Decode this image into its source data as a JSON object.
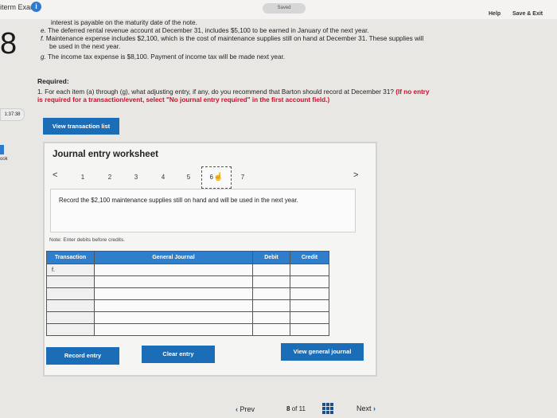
{
  "header": {
    "exam_title": "iterm Exam",
    "saved_label": "Saved",
    "help_label": "Help",
    "save_exit_label": "Save & Exit"
  },
  "left_rail": {
    "question_number": "8",
    "timer": "1:37:38",
    "rail_label": "ook"
  },
  "problem": {
    "lines": [
      {
        "label": "",
        "text": "interest is payable on the maturity date of the note."
      },
      {
        "label": "e.",
        "text": "The deferred rental revenue account at December 31, includes $5,100 to be earned in January of the next year."
      },
      {
        "label": "f.",
        "text": "Maintenance expense includes $2,100, which is the cost of maintenance supplies still on hand at December 31. These supplies will"
      },
      {
        "label": "",
        "text": "be used in the next year."
      },
      {
        "label": "g.",
        "text": "The income tax expense is $8,100. Payment of income tax will be made next year."
      }
    ]
  },
  "required": {
    "title": "Required:",
    "text": "1. For each item (a) through (g), what adjusting entry, if any, do you recommend that Barton should record at December 31? ",
    "red_part1": "(If no entry",
    "red_part2": "is required for a transaction/event, select \"No journal entry required\" in the first account field.)"
  },
  "buttons": {
    "view_transaction_list": "View transaction list",
    "record_entry": "Record entry",
    "clear_entry": "Clear entry",
    "view_general_journal": "View general journal"
  },
  "worksheet": {
    "title": "Journal entry worksheet",
    "prev_arrow": "<",
    "next_arrow": ">",
    "steps": [
      "1",
      "2",
      "3",
      "4",
      "5",
      "6",
      "7"
    ],
    "active_step": "6",
    "instruction": "Record the $2,100 maintenance supplies still on hand and will be used in the next year.",
    "note": "Note: Enter debits before credits."
  },
  "journal_table": {
    "headers": [
      "Transaction",
      "General Journal",
      "Debit",
      "Credit"
    ],
    "first_transaction": "f."
  },
  "bottom_nav": {
    "prev_label": "Prev",
    "page_current": "8",
    "page_of": "of",
    "page_total": "11",
    "next_label": "Next"
  },
  "colors": {
    "accent_blue": "#1b6db8",
    "header_blue": "#2f7ecb",
    "required_red": "#c8102e"
  }
}
